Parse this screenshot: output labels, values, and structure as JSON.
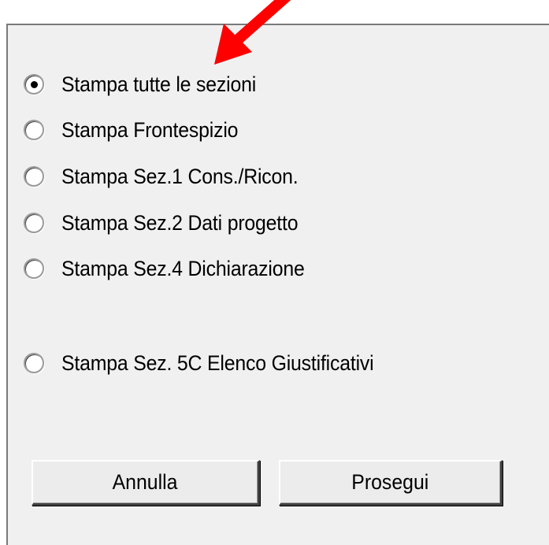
{
  "options": [
    {
      "label": "Stampa tutte le sezioni",
      "checked": true
    },
    {
      "label": "Stampa Frontespizio",
      "checked": false
    },
    {
      "label": "Stampa Sez.1 Cons./Ricon.",
      "checked": false
    },
    {
      "label": "Stampa Sez.2 Dati progetto",
      "checked": false
    },
    {
      "label": "Stampa Sez.4 Dichiarazione",
      "checked": false
    },
    {
      "label": "Stampa Sez. 5C Elenco Giustificativi",
      "checked": false
    }
  ],
  "buttons": {
    "cancel_label": "Annulla",
    "continue_label": "Prosegui"
  },
  "annotation": {
    "arrow_color": "#ff0000"
  }
}
